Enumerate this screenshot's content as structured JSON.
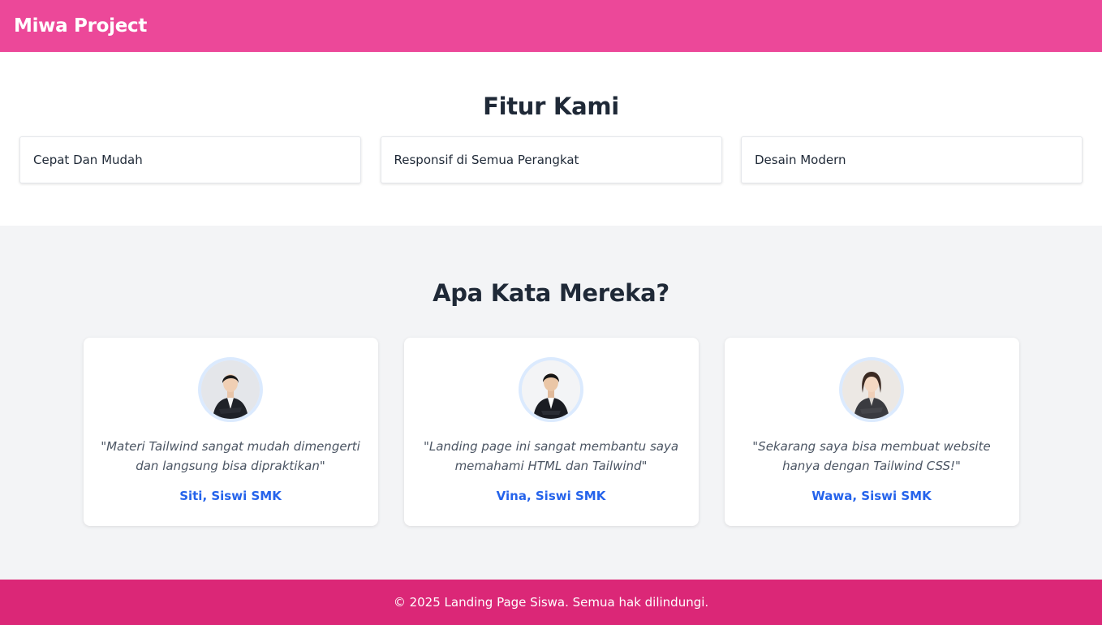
{
  "navbar": {
    "brand": "Miwa Project"
  },
  "features": {
    "title": "Fitur Kami",
    "items": [
      {
        "label": "Cepat Dan Mudah"
      },
      {
        "label": "Responsif di Semua Perangkat"
      },
      {
        "label": "Desain Modern"
      }
    ]
  },
  "testimonials": {
    "title": "Apa Kata Mereka?",
    "items": [
      {
        "quote": "\"Materi Tailwind sangat mudah dimengerti dan langsung bisa dipraktikan\"",
        "author": "Siti, Siswi SMK",
        "avatar_icon": "woman-portrait-avatar"
      },
      {
        "quote": "\"Landing page ini sangat membantu saya memahami HTML dan Tailwind\"",
        "author": "Vina, Siswi SMK",
        "avatar_icon": "woman-portrait-avatar"
      },
      {
        "quote": "\"Sekarang saya bisa membuat website hanya dengan Tailwind CSS!\"",
        "author": "Wawa, Siswi SMK",
        "avatar_icon": "woman-portrait-avatar"
      }
    ]
  },
  "footer": {
    "text": "© 2025 Landing Page Siswa. Semua hak dilindungi."
  },
  "colors": {
    "navbar": "#ec4899",
    "footer": "#db2777",
    "accent": "#2563eb",
    "section_bg": "#f3f4f6"
  }
}
